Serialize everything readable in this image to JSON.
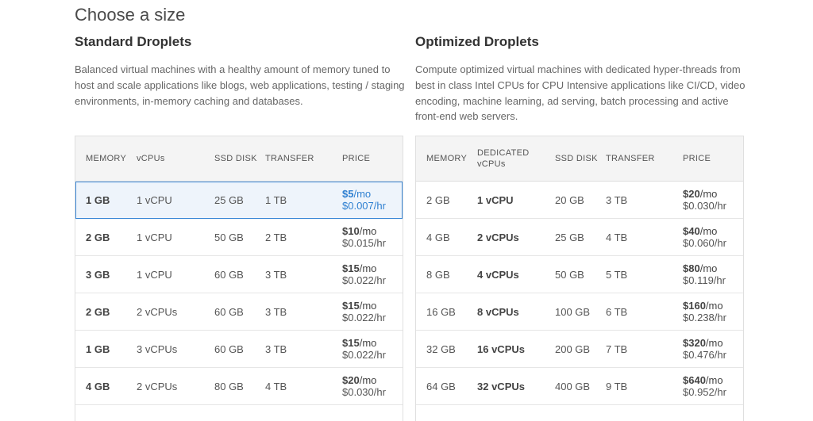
{
  "page_title": "Choose a size",
  "standard": {
    "heading": "Standard Droplets",
    "description": "Balanced virtual machines with a healthy amount of memory tuned to host and scale applications like blogs, web applications, testing / staging environments, in-memory caching and databases.",
    "headers": {
      "memory": "MEMORY",
      "cpu": "vCPUs",
      "ssd": "SSD DISK",
      "transfer": "TRANSFER",
      "price": "PRICE"
    },
    "rows": [
      {
        "memory": "1 GB",
        "cpu": "1 vCPU",
        "ssd": "25 GB",
        "transfer": "1 TB",
        "price_mo": "$5",
        "price_hr": "$0.007/hr",
        "selected": true
      },
      {
        "memory": "2 GB",
        "cpu": "1 vCPU",
        "ssd": "50 GB",
        "transfer": "2 TB",
        "price_mo": "$10",
        "price_hr": "$0.015/hr",
        "selected": false
      },
      {
        "memory": "3 GB",
        "cpu": "1 vCPU",
        "ssd": "60 GB",
        "transfer": "3 TB",
        "price_mo": "$15",
        "price_hr": "$0.022/hr",
        "selected": false
      },
      {
        "memory": "2 GB",
        "cpu": "2 vCPUs",
        "ssd": "60 GB",
        "transfer": "3 TB",
        "price_mo": "$15",
        "price_hr": "$0.022/hr",
        "selected": false
      },
      {
        "memory": "1 GB",
        "cpu": "3 vCPUs",
        "ssd": "60 GB",
        "transfer": "3 TB",
        "price_mo": "$15",
        "price_hr": "$0.022/hr",
        "selected": false
      },
      {
        "memory": "4 GB",
        "cpu": "2 vCPUs",
        "ssd": "80 GB",
        "transfer": "4 TB",
        "price_mo": "$20",
        "price_hr": "$0.030/hr",
        "selected": false
      }
    ]
  },
  "optimized": {
    "heading": "Optimized Droplets",
    "description": "Compute optimized virtual machines with dedicated hyper-threads from best in class Intel CPUs for CPU Intensive applications like CI/CD, video encoding, machine learning, ad serving, batch processing and active front-end web servers.",
    "headers": {
      "memory": "MEMORY",
      "cpu_line1": "DEDICATED",
      "cpu_line2": "vCPUs",
      "ssd": "SSD DISK",
      "transfer": "TRANSFER",
      "price": "PRICE"
    },
    "rows": [
      {
        "memory": "2 GB",
        "cpu": "1 vCPU",
        "ssd": "20 GB",
        "transfer": "3 TB",
        "price_mo": "$20",
        "price_hr": "$0.030/hr"
      },
      {
        "memory": "4 GB",
        "cpu": "2 vCPUs",
        "ssd": "25 GB",
        "transfer": "4 TB",
        "price_mo": "$40",
        "price_hr": "$0.060/hr"
      },
      {
        "memory": "8 GB",
        "cpu": "4 vCPUs",
        "ssd": "50 GB",
        "transfer": "5 TB",
        "price_mo": "$80",
        "price_hr": "$0.119/hr"
      },
      {
        "memory": "16 GB",
        "cpu": "8 vCPUs",
        "ssd": "100 GB",
        "transfer": "6 TB",
        "price_mo": "$160",
        "price_hr": "$0.238/hr"
      },
      {
        "memory": "32 GB",
        "cpu": "16 vCPUs",
        "ssd": "200 GB",
        "transfer": "7 TB",
        "price_mo": "$320",
        "price_hr": "$0.476/hr"
      },
      {
        "memory": "64 GB",
        "cpu": "32 vCPUs",
        "ssd": "400 GB",
        "transfer": "9 TB",
        "price_mo": "$640",
        "price_hr": "$0.952/hr"
      }
    ]
  },
  "price_unit": "/mo",
  "colors": {
    "accent": "#2f80d1",
    "selected_bg": "#eef4fb",
    "header_bg": "#f4f4f4",
    "border": "#dfdfdf"
  }
}
